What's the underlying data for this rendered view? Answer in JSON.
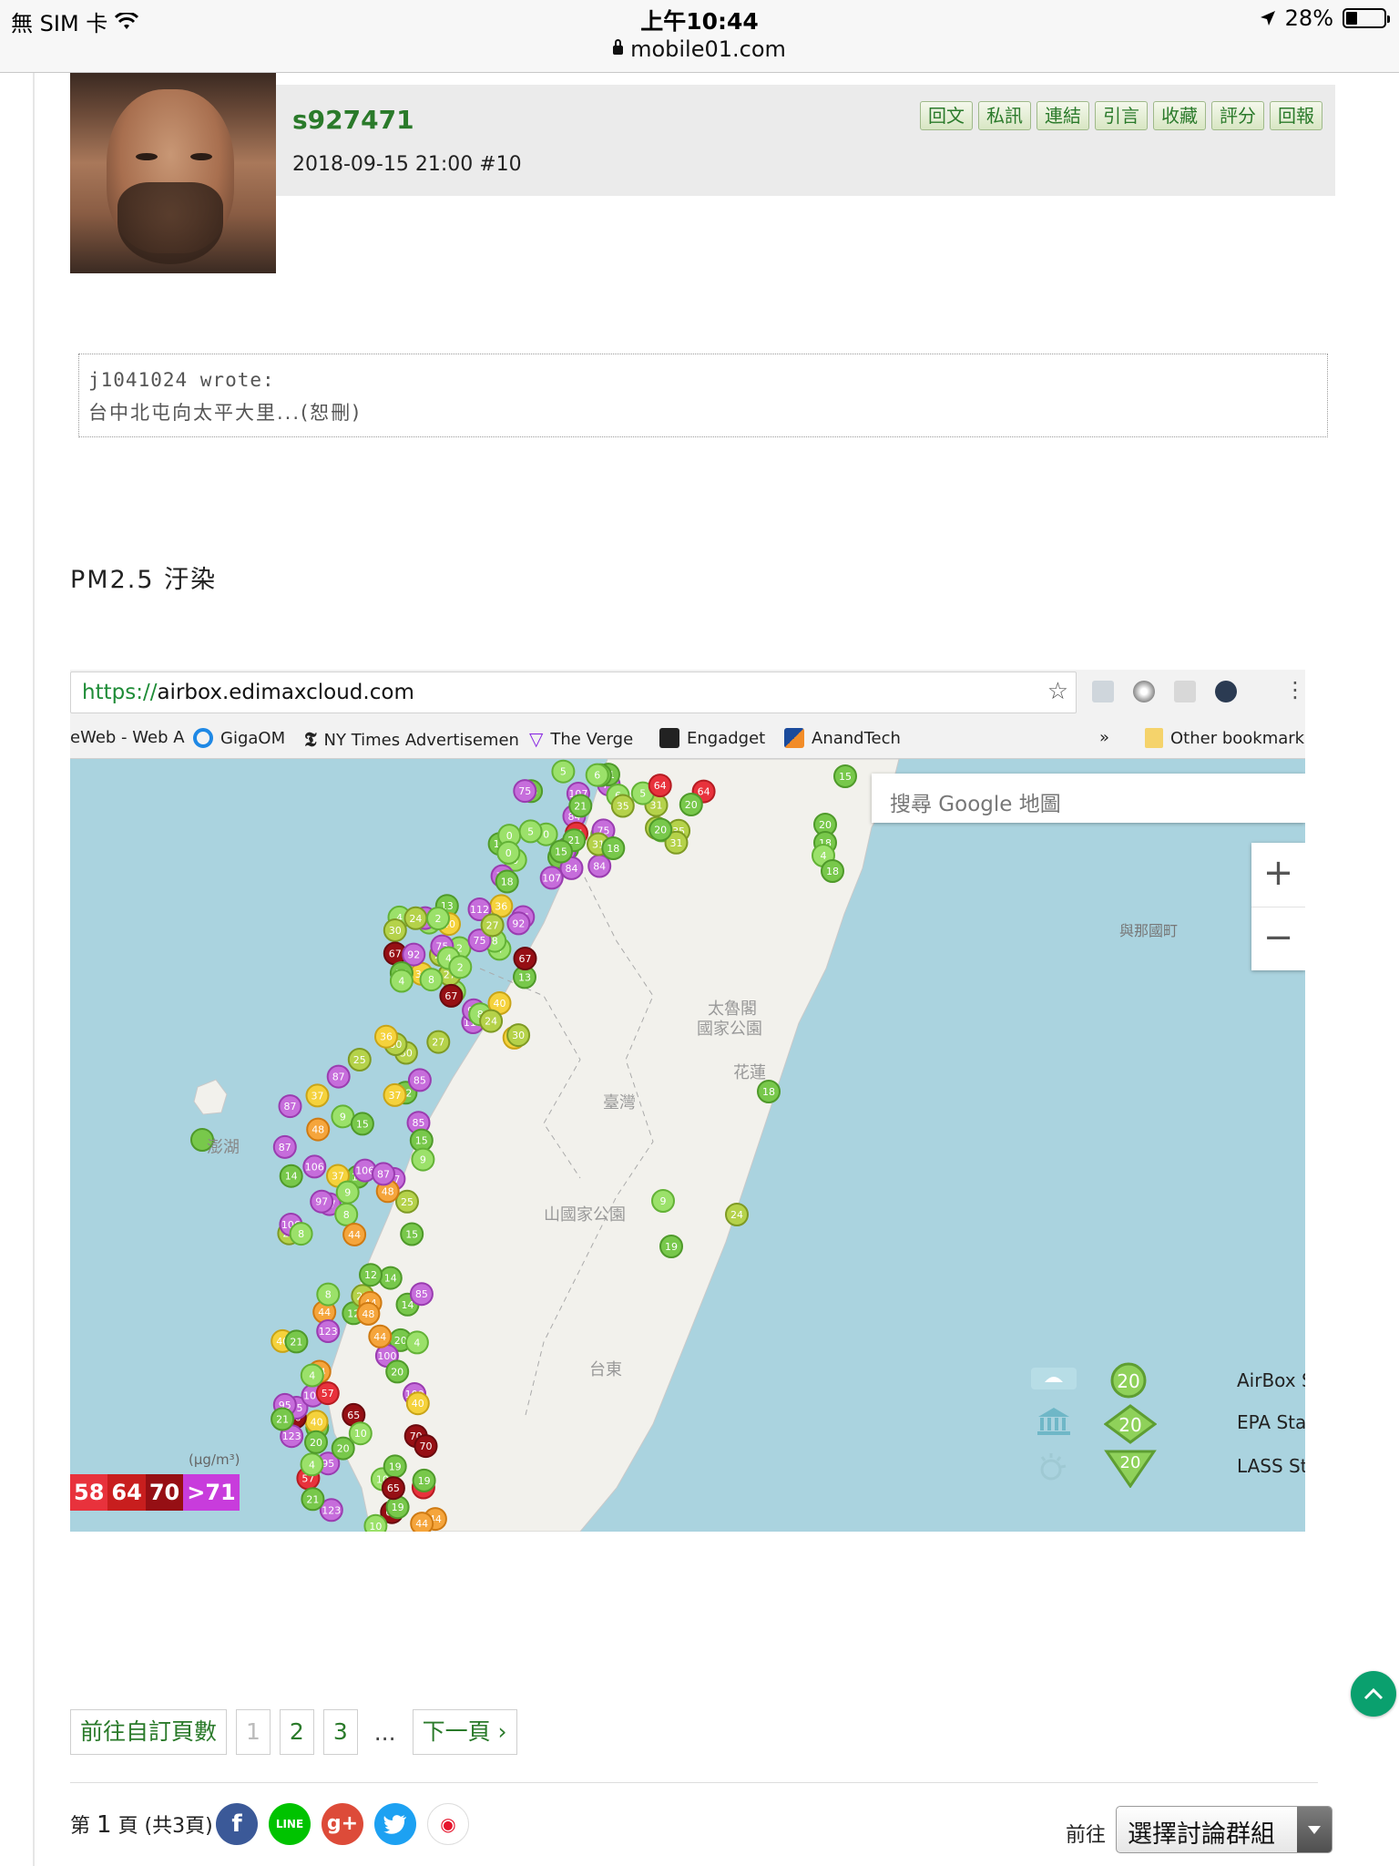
{
  "status_bar": {
    "carrier": "無 SIM 卡",
    "time": "上午10:44",
    "url": "mobile01.com",
    "battery": "28%"
  },
  "post": {
    "username": "s927471",
    "meta": "2018-09-15 21:00  #10",
    "actions": [
      "回文",
      "私訊",
      "連結",
      "引言",
      "收藏",
      "評分",
      "回報"
    ]
  },
  "quote": {
    "author": "j1041024 wrote:",
    "text": "台中北屯向太平大里...(恕刪)"
  },
  "heading": "PM2.5 汙染",
  "embedded_browser": {
    "url_scheme": "https://",
    "url_rest": "airbox.edimaxcloud.com",
    "bookmarks": [
      "eWeb - Web A",
      "GigaOM",
      "NY Times Advertisemen",
      "The Verge",
      "Engadget",
      "AnandTech",
      "»",
      "Other bookmarks"
    ],
    "map_search_placeholder": "搜尋 Google 地圖",
    "zoom_in": "+",
    "zoom_out": "−",
    "place_labels": [
      "太魯閣",
      "國家公園",
      "臺灣",
      "花蓮",
      "山國家公園",
      "台東",
      "與那國町",
      "澎湖"
    ],
    "legend": {
      "items": [
        {
          "label": "AirBox Station",
          "value": "20"
        },
        {
          "label": "EPA Station",
          "value": "20"
        },
        {
          "label": "LASS Station",
          "value": "20"
        }
      ],
      "unit": "(μg/m³)",
      "scale": [
        {
          "text": "58",
          "color": "#e8323c"
        },
        {
          "text": "64",
          "color": "#c81e1e"
        },
        {
          "text": "70",
          "color": "#960f14"
        },
        {
          "text": ">71",
          "color": "#c83cdc"
        }
      ]
    },
    "station_values": [
      "5",
      "8",
      "15",
      "20",
      "18",
      "4",
      "25",
      "21",
      "0",
      "2",
      "87",
      "44",
      "75",
      "30",
      "106",
      "95",
      "64",
      "36",
      "97",
      "100",
      "84",
      "75",
      "85",
      "40",
      "107",
      "112",
      "37",
      "70",
      "21",
      "92",
      "44",
      "65",
      "35",
      "27",
      "48",
      "57",
      "31",
      "40",
      "14",
      "10",
      "15",
      "24",
      "9",
      "19",
      "20",
      "13",
      "8",
      "4",
      "6",
      "67",
      "12",
      "123"
    ]
  },
  "pagination": {
    "custom_page": "前往自訂頁數",
    "pages": [
      "1",
      "2",
      "3"
    ],
    "ellipsis": "...",
    "next": "下一頁 ›",
    "page_info_prefix": "第",
    "page_info_current": "1",
    "page_info_suffix": "頁 (共3頁)"
  },
  "footer": {
    "goto_label": "前往",
    "select_value": "選擇討論群組"
  },
  "social": [
    {
      "name": "facebook",
      "glyph": "f",
      "color": "#3b5998"
    },
    {
      "name": "line",
      "glyph": "LINE",
      "color": "#00c300"
    },
    {
      "name": "google-plus",
      "glyph": "g+",
      "color": "#dd4b39"
    },
    {
      "name": "twitter",
      "glyph": "t",
      "color": "#1da1f2"
    },
    {
      "name": "weibo",
      "glyph": "微",
      "color": "#ffffff"
    }
  ]
}
